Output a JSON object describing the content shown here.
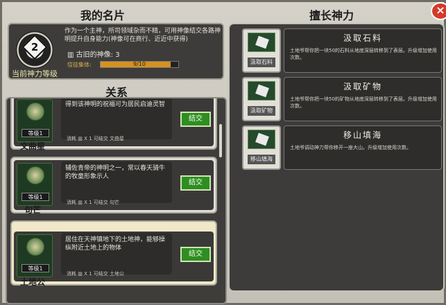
{
  "header": {
    "card_title": "我的名片",
    "skills_title": "擅长神力",
    "relations_title": "关系"
  },
  "profile": {
    "level": "2",
    "level_label": "当前神力等级",
    "description": "作为一个主神，所司领域杂而不精，可用神像结交各路神明提升自身能力(神像可在商行、近近中获得)",
    "ancient_label": "古旧的神像:",
    "ancient_count": "3",
    "progress_label": "信徒集体:",
    "progress_text": "9/10",
    "progress_fraction": 0.9
  },
  "relations": [
    {
      "name": "文曲星",
      "level": "等级1",
      "description": "得到该神明的祝福可为居民启迪灵智",
      "cost": "消耗",
      "cost_detail": "X 1 可结交 文曲星",
      "bond": "结交"
    },
    {
      "name": "句芒",
      "level": "等级1",
      "description": "辅佐青帝的神明之一，常以春天骑牛的牧童形象示人",
      "cost": "消耗",
      "cost_detail": "X 1 可结交 句芒",
      "bond": "结交"
    },
    {
      "name": "土地公",
      "level": "等级1",
      "description": "居住在天神镇地下的土地神，能够操纵附近土地上的物体",
      "cost": "消耗",
      "cost_detail": "X 1 可结交 土地公",
      "bond": "结交"
    }
  ],
  "skills": [
    {
      "title": "汲取石料",
      "icon_label": "汲取石料",
      "icon": "stone-icon",
      "description": "土地爷帮你把一块50的石料从地底深层转移到了表层。升级增加使用次数。"
    },
    {
      "title": "汲取矿物",
      "icon_label": "汲取矿物",
      "icon": "ore-icon",
      "description": "土地爷帮你把一块50的矿物从地底深层转移到了表层。升级增加使用次数。"
    },
    {
      "title": "移山填海",
      "icon_label": "移山填海",
      "icon": "mountain-icon",
      "description": "土地爷调动神力帮你移开一座大山。升级增加使用次数。"
    }
  ],
  "close": "×"
}
